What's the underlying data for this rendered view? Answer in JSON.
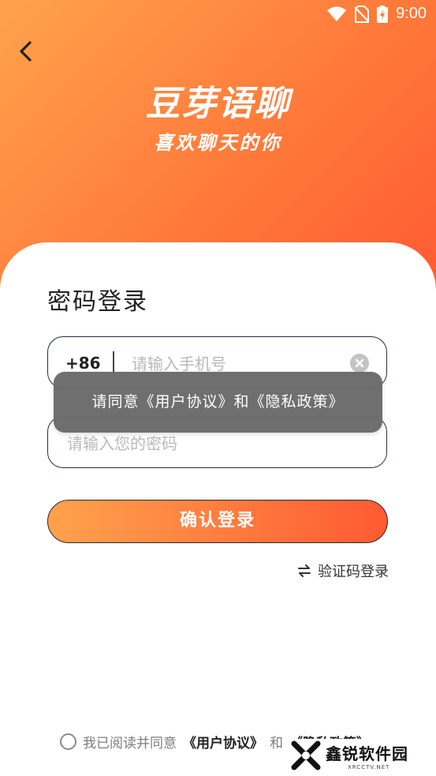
{
  "status_bar": {
    "time": "9:00"
  },
  "brand": {
    "title": "豆芽语聊",
    "subtitle": "喜欢聊天的你"
  },
  "login": {
    "title": "密码登录",
    "country_code": "+86",
    "phone_placeholder": "请输入手机号",
    "password_placeholder": "请输入您的密码",
    "submit_label": "确认登录",
    "switch_label": "验证码登录"
  },
  "toast": {
    "message": "请同意《用户协议》和《隐私政策》"
  },
  "agreement": {
    "prefix": "我已阅读并同意",
    "user_agreement": "《用户协议》",
    "conjunction": "和",
    "privacy_policy": "《隐私政策》"
  },
  "watermark": {
    "main": "鑫锐软件园",
    "sub": "XRCCTV.NET"
  },
  "colors": {
    "accent_start": "#ffa24c",
    "accent_end": "#ff5a32"
  }
}
